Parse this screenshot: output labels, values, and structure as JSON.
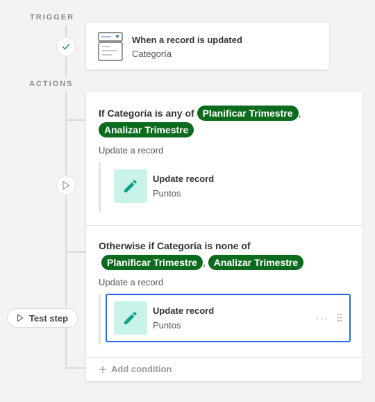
{
  "sections": {
    "trigger_label": "TRIGGER",
    "actions_label": "ACTIONS"
  },
  "trigger": {
    "title": "When a record is updated",
    "subtitle": "Categoría"
  },
  "condition_1": {
    "prefix": "If Categoría is any of",
    "chips": [
      "Planificar Trimestre",
      "Analizar Trimestre"
    ],
    "comma": ",",
    "action_label": "Update a record",
    "step": {
      "title": "Update record",
      "subtitle": "Puntos"
    }
  },
  "condition_2": {
    "prefix": "Otherwise if Categoría is none of",
    "chips": [
      "Planificar Trimestre",
      "Analizar Trimestre"
    ],
    "comma": ",",
    "action_label": "Update a record",
    "step": {
      "title": "Update record",
      "subtitle": "Puntos"
    }
  },
  "footer": {
    "add_condition": "Add condition"
  },
  "test_step": {
    "label": "Test step"
  },
  "colors": {
    "chip_bg": "#0c6b1d",
    "icon_bg": "#c7f3e8",
    "icon_fg": "#0f9f89",
    "selected_border": "#1d6fe0"
  }
}
